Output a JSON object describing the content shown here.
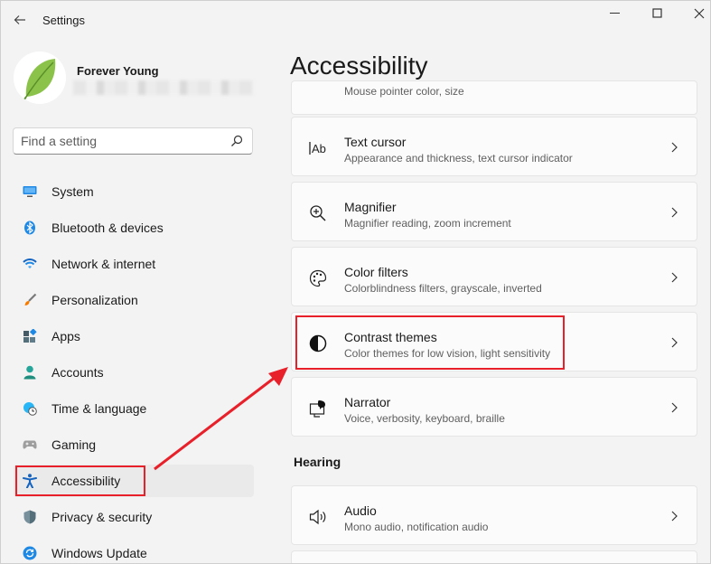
{
  "window": {
    "title": "Settings"
  },
  "profile": {
    "name": "Forever Young"
  },
  "search": {
    "placeholder": "Find a setting"
  },
  "nav": {
    "items": [
      {
        "label": "System",
        "icon": "monitor-icon"
      },
      {
        "label": "Bluetooth & devices",
        "icon": "bluetooth-icon"
      },
      {
        "label": "Network & internet",
        "icon": "wifi-icon"
      },
      {
        "label": "Personalization",
        "icon": "brush-icon"
      },
      {
        "label": "Apps",
        "icon": "apps-icon"
      },
      {
        "label": "Accounts",
        "icon": "person-icon"
      },
      {
        "label": "Time & language",
        "icon": "globe-clock-icon"
      },
      {
        "label": "Gaming",
        "icon": "gamepad-icon"
      },
      {
        "label": "Accessibility",
        "icon": "accessibility-icon",
        "selected": true
      },
      {
        "label": "Privacy & security",
        "icon": "shield-icon"
      },
      {
        "label": "Windows Update",
        "icon": "update-icon"
      }
    ]
  },
  "main": {
    "title": "Accessibility",
    "partial_card_text": "Mouse pointer color, size",
    "cards": [
      {
        "title": "Text cursor",
        "subtitle": "Appearance and thickness, text cursor indicator",
        "icon": "text-cursor-icon"
      },
      {
        "title": "Magnifier",
        "subtitle": "Magnifier reading, zoom increment",
        "icon": "magnifier-icon"
      },
      {
        "title": "Color filters",
        "subtitle": "Colorblindness filters, grayscale, inverted",
        "icon": "palette-icon"
      },
      {
        "title": "Contrast themes",
        "subtitle": "Color themes for low vision, light sensitivity",
        "icon": "contrast-icon"
      },
      {
        "title": "Narrator",
        "subtitle": "Voice, verbosity, keyboard, braille",
        "icon": "narrator-icon"
      }
    ],
    "hearing_section": "Hearing",
    "hearing_cards": [
      {
        "title": "Audio",
        "subtitle": "Mono audio, notification audio",
        "icon": "speaker-icon"
      }
    ]
  },
  "colors": {
    "annotation": "#e8202a",
    "accent": "#0067c0"
  }
}
